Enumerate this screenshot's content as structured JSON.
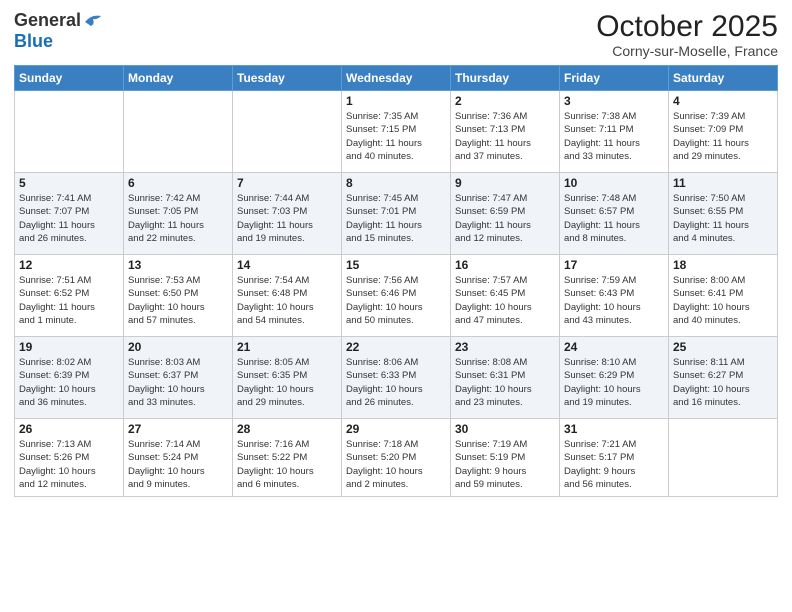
{
  "header": {
    "logo_general": "General",
    "logo_blue": "Blue",
    "month_title": "October 2025",
    "location": "Corny-sur-Moselle, France"
  },
  "weekdays": [
    "Sunday",
    "Monday",
    "Tuesday",
    "Wednesday",
    "Thursday",
    "Friday",
    "Saturday"
  ],
  "weeks": [
    [
      {
        "day": "",
        "info": ""
      },
      {
        "day": "",
        "info": ""
      },
      {
        "day": "",
        "info": ""
      },
      {
        "day": "1",
        "info": "Sunrise: 7:35 AM\nSunset: 7:15 PM\nDaylight: 11 hours\nand 40 minutes."
      },
      {
        "day": "2",
        "info": "Sunrise: 7:36 AM\nSunset: 7:13 PM\nDaylight: 11 hours\nand 37 minutes."
      },
      {
        "day": "3",
        "info": "Sunrise: 7:38 AM\nSunset: 7:11 PM\nDaylight: 11 hours\nand 33 minutes."
      },
      {
        "day": "4",
        "info": "Sunrise: 7:39 AM\nSunset: 7:09 PM\nDaylight: 11 hours\nand 29 minutes."
      }
    ],
    [
      {
        "day": "5",
        "info": "Sunrise: 7:41 AM\nSunset: 7:07 PM\nDaylight: 11 hours\nand 26 minutes."
      },
      {
        "day": "6",
        "info": "Sunrise: 7:42 AM\nSunset: 7:05 PM\nDaylight: 11 hours\nand 22 minutes."
      },
      {
        "day": "7",
        "info": "Sunrise: 7:44 AM\nSunset: 7:03 PM\nDaylight: 11 hours\nand 19 minutes."
      },
      {
        "day": "8",
        "info": "Sunrise: 7:45 AM\nSunset: 7:01 PM\nDaylight: 11 hours\nand 15 minutes."
      },
      {
        "day": "9",
        "info": "Sunrise: 7:47 AM\nSunset: 6:59 PM\nDaylight: 11 hours\nand 12 minutes."
      },
      {
        "day": "10",
        "info": "Sunrise: 7:48 AM\nSunset: 6:57 PM\nDaylight: 11 hours\nand 8 minutes."
      },
      {
        "day": "11",
        "info": "Sunrise: 7:50 AM\nSunset: 6:55 PM\nDaylight: 11 hours\nand 4 minutes."
      }
    ],
    [
      {
        "day": "12",
        "info": "Sunrise: 7:51 AM\nSunset: 6:52 PM\nDaylight: 11 hours\nand 1 minute."
      },
      {
        "day": "13",
        "info": "Sunrise: 7:53 AM\nSunset: 6:50 PM\nDaylight: 10 hours\nand 57 minutes."
      },
      {
        "day": "14",
        "info": "Sunrise: 7:54 AM\nSunset: 6:48 PM\nDaylight: 10 hours\nand 54 minutes."
      },
      {
        "day": "15",
        "info": "Sunrise: 7:56 AM\nSunset: 6:46 PM\nDaylight: 10 hours\nand 50 minutes."
      },
      {
        "day": "16",
        "info": "Sunrise: 7:57 AM\nSunset: 6:45 PM\nDaylight: 10 hours\nand 47 minutes."
      },
      {
        "day": "17",
        "info": "Sunrise: 7:59 AM\nSunset: 6:43 PM\nDaylight: 10 hours\nand 43 minutes."
      },
      {
        "day": "18",
        "info": "Sunrise: 8:00 AM\nSunset: 6:41 PM\nDaylight: 10 hours\nand 40 minutes."
      }
    ],
    [
      {
        "day": "19",
        "info": "Sunrise: 8:02 AM\nSunset: 6:39 PM\nDaylight: 10 hours\nand 36 minutes."
      },
      {
        "day": "20",
        "info": "Sunrise: 8:03 AM\nSunset: 6:37 PM\nDaylight: 10 hours\nand 33 minutes."
      },
      {
        "day": "21",
        "info": "Sunrise: 8:05 AM\nSunset: 6:35 PM\nDaylight: 10 hours\nand 29 minutes."
      },
      {
        "day": "22",
        "info": "Sunrise: 8:06 AM\nSunset: 6:33 PM\nDaylight: 10 hours\nand 26 minutes."
      },
      {
        "day": "23",
        "info": "Sunrise: 8:08 AM\nSunset: 6:31 PM\nDaylight: 10 hours\nand 23 minutes."
      },
      {
        "day": "24",
        "info": "Sunrise: 8:10 AM\nSunset: 6:29 PM\nDaylight: 10 hours\nand 19 minutes."
      },
      {
        "day": "25",
        "info": "Sunrise: 8:11 AM\nSunset: 6:27 PM\nDaylight: 10 hours\nand 16 minutes."
      }
    ],
    [
      {
        "day": "26",
        "info": "Sunrise: 7:13 AM\nSunset: 5:26 PM\nDaylight: 10 hours\nand 12 minutes."
      },
      {
        "day": "27",
        "info": "Sunrise: 7:14 AM\nSunset: 5:24 PM\nDaylight: 10 hours\nand 9 minutes."
      },
      {
        "day": "28",
        "info": "Sunrise: 7:16 AM\nSunset: 5:22 PM\nDaylight: 10 hours\nand 6 minutes."
      },
      {
        "day": "29",
        "info": "Sunrise: 7:18 AM\nSunset: 5:20 PM\nDaylight: 10 hours\nand 2 minutes."
      },
      {
        "day": "30",
        "info": "Sunrise: 7:19 AM\nSunset: 5:19 PM\nDaylight: 9 hours\nand 59 minutes."
      },
      {
        "day": "31",
        "info": "Sunrise: 7:21 AM\nSunset: 5:17 PM\nDaylight: 9 hours\nand 56 minutes."
      },
      {
        "day": "",
        "info": ""
      }
    ]
  ]
}
